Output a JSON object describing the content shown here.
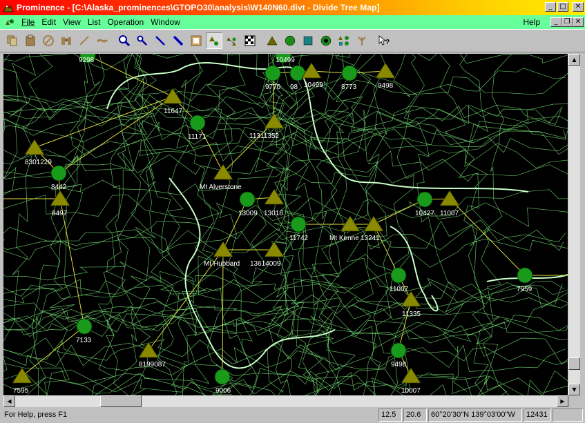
{
  "window": {
    "title": "Prominence - [C:\\Alaska_prominences\\GTOPO30\\analysis\\W140N60.divt - Divide Tree Map]",
    "minimize": "_",
    "maximize": "□",
    "close": "✕",
    "restore": "❐"
  },
  "menu": {
    "file": "File",
    "edit": "Edit",
    "view": "View",
    "list": "List",
    "operation": "Operation",
    "window": "Window",
    "help": "Help"
  },
  "toolbar": {
    "buttons": [
      {
        "icon": "copy-icon"
      },
      {
        "icon": "paste-icon"
      },
      {
        "icon": "no-entry-icon"
      },
      {
        "icon": "binoculars-icon"
      },
      {
        "icon": "line-tool-icon"
      },
      {
        "icon": "pencil-icon"
      },
      {
        "icon": "zoom-in-icon"
      },
      {
        "icon": "zoom-out-icon"
      },
      {
        "icon": "draw-line-icon"
      },
      {
        "icon": "draw-line-bold-icon"
      },
      {
        "icon": "frame-icon"
      },
      {
        "icon": "peaks-view-icon"
      },
      {
        "icon": "tree-view-icon"
      },
      {
        "icon": "checker-icon"
      },
      {
        "icon": "peak-triangle-icon"
      },
      {
        "icon": "saddle-circle-icon"
      },
      {
        "icon": "runoff-square-icon"
      },
      {
        "icon": "basin-saddle-icon"
      },
      {
        "icon": "all-features-icon"
      },
      {
        "icon": "tree-icon"
      },
      {
        "icon": "help-pointer-icon"
      }
    ]
  },
  "map": {
    "colors": {
      "background": "#000000",
      "contour": "#7ef07e",
      "contour_bold": "#c8ffc8",
      "peak": "#8a8a00",
      "saddle": "#1a9a1a",
      "divide": "#e0e040"
    },
    "peaks": [
      {
        "id": "p11647",
        "label": "11647"
      },
      {
        "id": "p8301",
        "label": "8301229"
      },
      {
        "id": "p8497",
        "label": "8497"
      },
      {
        "id": "palv",
        "label": "Mt Alverstone"
      },
      {
        "id": "p1352",
        "label": "11311352"
      },
      {
        "id": "p13018",
        "label": "13018"
      },
      {
        "id": "phub",
        "label": "Mt Hubbard"
      },
      {
        "id": "p4009",
        "label": "13614009"
      },
      {
        "id": "pken",
        "label": "Mt Kenne"
      },
      {
        "id": "p13241",
        "label": "13241"
      },
      {
        "id": "p11007b",
        "label": "11007"
      },
      {
        "id": "p10499",
        "label": "10499"
      },
      {
        "id": "p9498",
        "label": "9498"
      },
      {
        "id": "p11335",
        "label": "11335"
      },
      {
        "id": "p8199",
        "label": "8199087"
      },
      {
        "id": "p7595",
        "label": "7595"
      },
      {
        "id": "p10007",
        "label": "10007"
      }
    ],
    "saddles": [
      {
        "id": "s9770",
        "label": "9770"
      },
      {
        "id": "s98",
        "label": "98"
      },
      {
        "id": "s8773",
        "label": "8773"
      },
      {
        "id": "s10499top",
        "label": "10499"
      },
      {
        "id": "s11171",
        "label": "11171"
      },
      {
        "id": "s8442",
        "label": "8442"
      },
      {
        "id": "s13009",
        "label": "13009"
      },
      {
        "id": "s11742",
        "label": "11742"
      },
      {
        "id": "s10427",
        "label": "10427"
      },
      {
        "id": "s11007",
        "label": "11007"
      },
      {
        "id": "s7959",
        "label": "7959"
      },
      {
        "id": "s7133",
        "label": "7133"
      },
      {
        "id": "s9498",
        "label": "9498"
      },
      {
        "id": "s9006",
        "label": "9006"
      },
      {
        "id": "s9298",
        "label": "9298"
      }
    ]
  },
  "status": {
    "help": "For Help, press F1",
    "v1": "12.5",
    "v2": "20.6",
    "coords": "60°20'30\"N 139°03'00\"W",
    "elev": "12431"
  }
}
